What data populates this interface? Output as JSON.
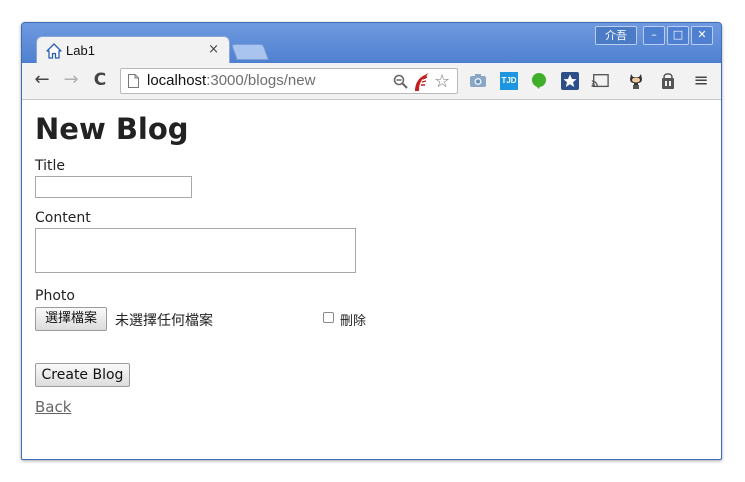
{
  "browser": {
    "tab_title": "Lab1",
    "tab_close": "×",
    "ime_label": "介吾",
    "window_buttons": {
      "minimize": "–",
      "maximize": "□",
      "close": "✕"
    },
    "nav": {
      "back": "←",
      "forward": "→",
      "reload": "C"
    },
    "url_host": "localhost",
    "url_path": ":3000/blogs/new",
    "star": "☆",
    "extensions": [
      "camera-icon",
      "tjd-icon",
      "evernote-icon",
      "star-badge-icon",
      "cast-icon",
      "octocat-icon",
      "privacy-icon",
      "menu-icon"
    ],
    "tjd_label": "TJD",
    "menu_glyph": "≡"
  },
  "page": {
    "heading": "New Blog",
    "form": {
      "title_label": "Title",
      "title_value": "",
      "content_label": "Content",
      "content_value": "",
      "photo_label": "Photo",
      "choose_file_button": "選擇檔案",
      "no_file_text": "未選擇任何檔案",
      "delete_label": "刪除",
      "delete_checked": false,
      "submit_button": "Create Blog"
    },
    "back_link": "Back"
  },
  "colors": {
    "titlebar": "#5a8ad6",
    "text": "#222222",
    "link": "#666666"
  }
}
